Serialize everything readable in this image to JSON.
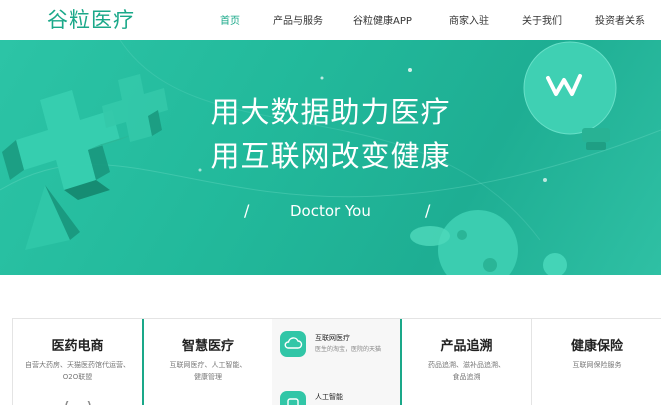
{
  "brand": {
    "logo": "谷粒医疗",
    "accent_color": "#1aa889"
  },
  "nav": {
    "items": [
      {
        "label": "首页",
        "active": true
      },
      {
        "label": "产品与服务",
        "active": false
      },
      {
        "label": "谷粒健康APP",
        "active": false
      },
      {
        "label": "商家入驻",
        "active": false
      },
      {
        "label": "关于我们",
        "active": false
      },
      {
        "label": "投资者关系",
        "active": false
      }
    ]
  },
  "banner": {
    "headline_1": "用大数据助力医疗",
    "headline_2": "用互联网改变健康",
    "slogan": "Doctor You",
    "slash": "/",
    "background_color": "#22b99b"
  },
  "cards": {
    "ecommerce": {
      "title": "医药电商",
      "desc_1": "自营大药房、天猫医药馆代运营、",
      "desc_2": "O2O联盟"
    },
    "smart": {
      "title": "智慧医疗",
      "desc_1": "互联网医疗、人工智能、",
      "desc_2": "健康管理"
    },
    "smart_sub": [
      {
        "title": "互联网医疗",
        "desc": "医生的淘宝，医院的天猫",
        "icon": "cloud-icon"
      },
      {
        "title": "人工智能",
        "desc": "",
        "icon": "robot-icon"
      }
    ],
    "trace": {
      "title": "产品追溯",
      "desc_1": "药品追溯、滋补品追溯、",
      "desc_2": "食品追溯"
    },
    "insurance": {
      "title": "健康保险",
      "desc_1": "互联网保险服务",
      "desc_2": ""
    }
  }
}
